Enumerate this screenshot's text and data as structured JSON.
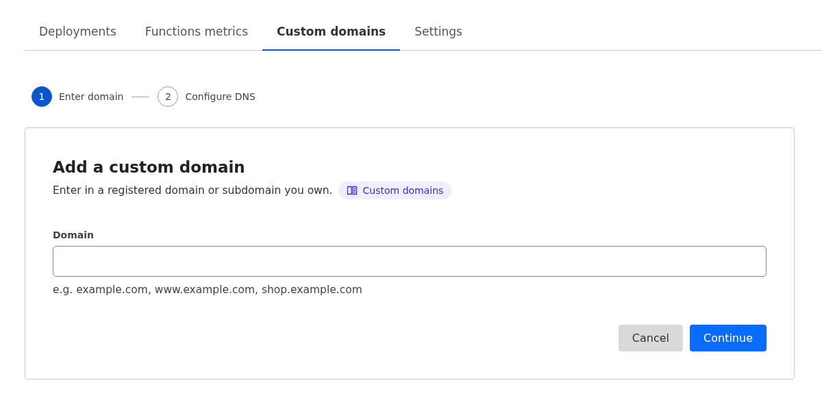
{
  "tabs": [
    {
      "label": "Deployments",
      "selected": false
    },
    {
      "label": "Functions metrics",
      "selected": false
    },
    {
      "label": "Custom domains",
      "selected": true
    },
    {
      "label": "Settings",
      "selected": false
    }
  ],
  "steps": [
    {
      "number": "1",
      "label": "Enter domain",
      "selected": true
    },
    {
      "number": "2",
      "label": "Configure DNS",
      "selected": false
    }
  ],
  "card": {
    "title": "Add a custom domain",
    "description": "Enter in a registered domain or subdomain you own.",
    "docs_link": "Custom domains",
    "field": {
      "label": "Domain",
      "hint": "e.g. example.com, www.example.com, shop.example.com"
    },
    "buttons": [
      {
        "label": "Cancel",
        "kind": "secondary"
      },
      {
        "label": "Continue",
        "kind": "primary"
      }
    ]
  }
}
